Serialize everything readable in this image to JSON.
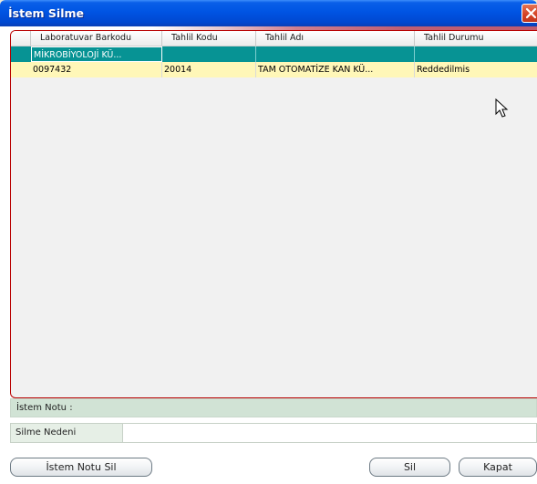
{
  "window": {
    "title": "İstem Silme"
  },
  "grid": {
    "columns": [
      "Laboratuvar Barkodu",
      "Tahlil Kodu",
      "Tahlil Adı",
      "Tahlil Durumu"
    ],
    "group_row": {
      "label": "MİKROBİYOLOJİ KÜ..."
    },
    "rows": [
      {
        "barkod": "0097432",
        "kod": "20014",
        "ad": "TAM OTOMATİZE KAN KÜ...",
        "durum": "Reddedilmis"
      }
    ]
  },
  "note": {
    "label": "İstem Notu :"
  },
  "reason": {
    "label": "Silme Nedeni",
    "value": ""
  },
  "buttons": {
    "note_delete": "İstem Notu Sil",
    "delete": "Sil",
    "close": "Kapat"
  },
  "colors": {
    "title_blue": "#0054e3",
    "group_teal": "#079394",
    "selected_yellow": "#fff7b8",
    "note_green": "#d1e3d5"
  }
}
